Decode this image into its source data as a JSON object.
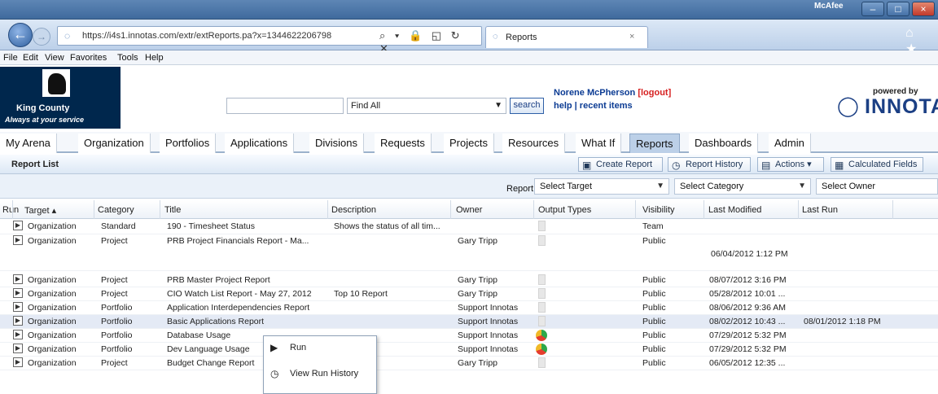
{
  "browser": {
    "address_url": "https://i4s1.innotas.com/extr/extReports.pa?x=1344622206798",
    "tab_title": "Reports",
    "mcafee": "McAfee",
    "back_icon": "back-arrow-icon",
    "forward_icon": "forward-arrow-icon",
    "address_controls": "⌕ ▾ 🔒 ◱ ↻ ✕",
    "nav_right": "⌂ ★"
  },
  "menu": [
    "File",
    "Edit",
    "View",
    "Favorites",
    "Tools",
    "Help"
  ],
  "org": {
    "name": "King County",
    "tagline": "Always at your service",
    "user_name": "Norene McPherson",
    "logout": "[logout]",
    "links": "help | recent items",
    "powered_by": "powered by",
    "brand": "INNOTA"
  },
  "search": {
    "placeholder": "",
    "select_value": "Find All",
    "button": "search"
  },
  "tabs": [
    "My Arena",
    "Organization",
    "Portfolios",
    "Applications",
    "Divisions",
    "Requests",
    "Projects",
    "Resources",
    "What If",
    "Reports",
    "Dashboards",
    "Admin"
  ],
  "active_tab": "Reports",
  "report_list": {
    "title": "Report List",
    "create_report": "Create Report",
    "report_history": "Report History",
    "actions": "Actions",
    "calculated_fields": "Calculated Fields"
  },
  "filters": {
    "report_for": "Report for",
    "target": "Select Target",
    "category": "Select Category",
    "owner": "Select Owner"
  },
  "columns": [
    "Run",
    "Target ▴",
    "Category",
    "Title",
    "Description",
    "Owner",
    "Output Types",
    "Visibility",
    "Last Modified",
    "Last Run"
  ],
  "rows": [
    {
      "target": "Organization",
      "category": "Standard",
      "title": "190 - Timesheet Status",
      "description": "Shows the status of all tim...",
      "owner": "",
      "output": "doc",
      "visibility": "Team",
      "last_modified": "",
      "last_run": ""
    },
    {
      "target": "Organization",
      "category": "Project",
      "title": "PRB Project Financials Report - Ma...",
      "description": "",
      "owner": "Gary Tripp",
      "output": "doc",
      "visibility": "Public",
      "last_modified": "06/04/2012 1:12 PM",
      "last_run": ""
    },
    {
      "target": "Organization",
      "category": "Project",
      "title": "PRB Master Project Report",
      "description": "",
      "owner": "Gary Tripp",
      "output": "doc",
      "visibility": "Public",
      "last_modified": "08/07/2012 3:16 PM",
      "last_run": ""
    },
    {
      "target": "Organization",
      "category": "Project",
      "title": "CIO Watch List Report - May 27, 2012",
      "description": "Top 10 Report",
      "owner": "Gary Tripp",
      "output": "doc",
      "visibility": "Public",
      "last_modified": "05/28/2012 10:01 ...",
      "last_run": ""
    },
    {
      "target": "Organization",
      "category": "Portfolio",
      "title": "Application Interdependencies Report",
      "description": "",
      "owner": "Support Innotas",
      "output": "doc",
      "visibility": "Public",
      "last_modified": "08/06/2012 9:36 AM",
      "last_run": ""
    },
    {
      "target": "Organization",
      "category": "Portfolio",
      "title": "Basic Applications Report",
      "description": "",
      "owner": "Support Innotas",
      "output": "doc",
      "visibility": "Public",
      "last_modified": "08/02/2012 10:43 ...",
      "last_run": "08/01/2012 1:18 PM"
    },
    {
      "target": "Organization",
      "category": "Portfolio",
      "title": "Database Usage",
      "description": "",
      "owner": "Support Innotas",
      "output": "chart",
      "visibility": "Public",
      "last_modified": "07/29/2012 5:32 PM",
      "last_run": ""
    },
    {
      "target": "Organization",
      "category": "Portfolio",
      "title": "Dev Language Usage",
      "description": "",
      "owner": "Support Innotas",
      "output": "chart",
      "visibility": "Public",
      "last_modified": "07/29/2012 5:32 PM",
      "last_run": ""
    },
    {
      "target": "Organization",
      "category": "Project",
      "title": "Budget Change Report",
      "description": "",
      "owner": "Gary Tripp",
      "output": "doc",
      "visibility": "Public",
      "last_modified": "06/05/2012 12:35 ...",
      "last_run": ""
    }
  ],
  "context_menu": {
    "run": "Run",
    "history": "View Run History"
  }
}
